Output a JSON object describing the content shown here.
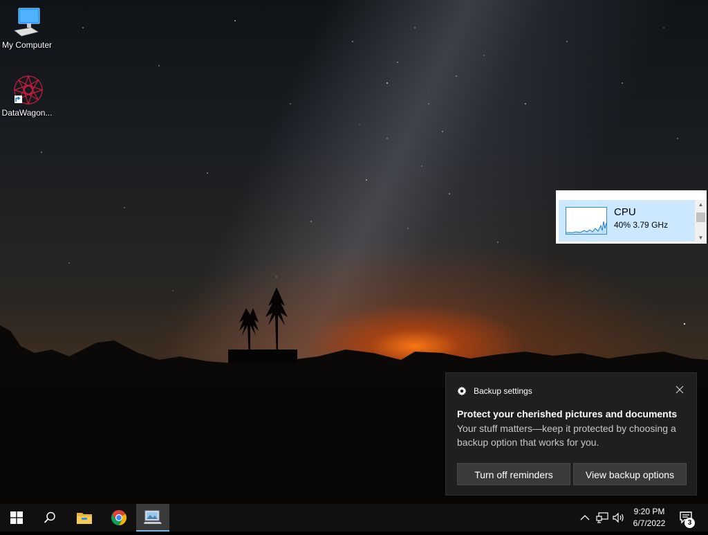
{
  "desktop": {
    "icons": [
      {
        "label": "My Computer",
        "icon": "computer-icon"
      },
      {
        "label": "DataWagon...",
        "icon": "datawagon-app-icon"
      }
    ]
  },
  "cpu_widget": {
    "title": "CPU",
    "usage": "40%",
    "speed": "3.79 GHz",
    "usage_fraction": 0.4
  },
  "toast": {
    "app_name": "Backup settings",
    "app_icon": "gear-icon",
    "title": "Protect your cherished pictures and documents",
    "body": "Your stuff matters—keep it protected by choosing a backup option that works for you.",
    "buttons": {
      "turn_off": "Turn off reminders",
      "view": "View backup options"
    }
  },
  "taskbar": {
    "pinned": [
      "start-button",
      "search-icon",
      "file-explorer-icon",
      "chrome-icon",
      "active-app-icon"
    ],
    "tray": [
      "chevron-up-icon",
      "network-icon",
      "volume-icon"
    ],
    "time": "9:20 PM",
    "date": "6/7/2022",
    "notification_count": "3"
  },
  "colors": {
    "taskbar": "#101010",
    "toast_bg": "#1f1f1f",
    "cpu_highlight": "#cce8ff",
    "accent": "#76b9ed"
  }
}
